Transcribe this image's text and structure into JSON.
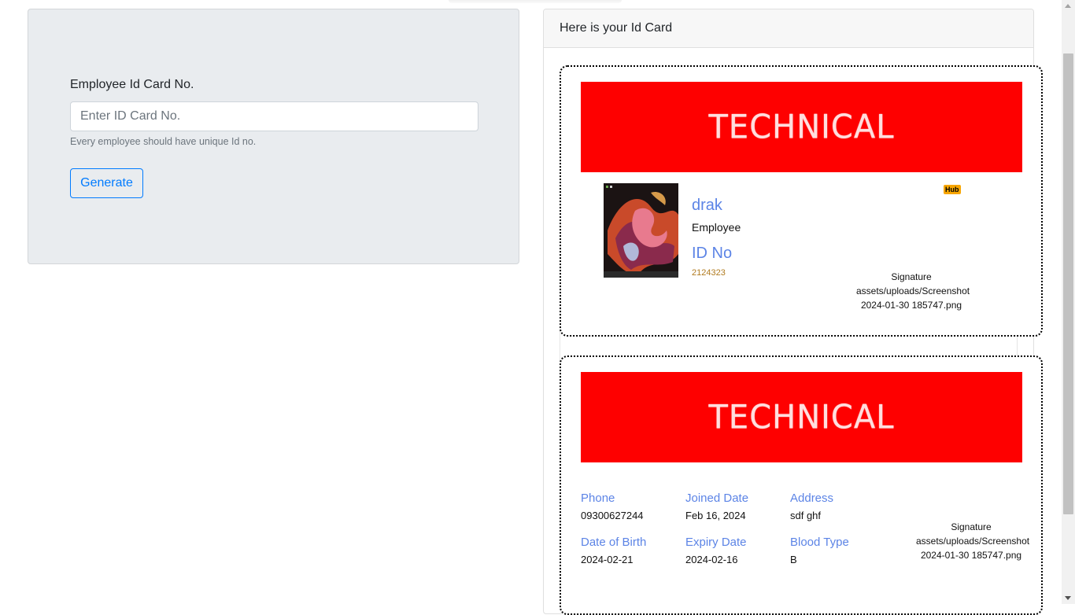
{
  "form": {
    "label": "Employee Id Card No.",
    "placeholder": "Enter ID Card No.",
    "help_text": "Every employee should have unique Id no.",
    "generate_label": "Generate"
  },
  "card_panel": {
    "header": "Here is your Id Card"
  },
  "front": {
    "banner_text": "TECHNICAL",
    "name": "drak",
    "role": "Employee",
    "id_label": "ID No",
    "id_value": "2124323",
    "badge": "Hub",
    "signature": "Signature assets/uploads/Screenshot 2024-01-30 185747.png"
  },
  "back": {
    "banner_text": "TECHNICAL",
    "phone_label": "Phone",
    "phone": "09300627244",
    "joined_label": "Joined Date",
    "joined": "Feb 16, 2024",
    "address_label": "Address",
    "address": "sdf ghf",
    "dob_label": "Date of Birth",
    "dob": "2024-02-21",
    "expiry_label": "Expiry Date",
    "expiry": "2024-02-16",
    "blood_label": "Blood Type",
    "blood": "B",
    "signature": "Signature assets/uploads/Screenshot 2024-01-30 185747.png"
  },
  "colors": {
    "banner": "#fe0000",
    "accent_blue": "#5c84e6",
    "button_blue": "#007bff",
    "id_value": "#b07a1e",
    "panel_bg": "#e9ecef"
  }
}
